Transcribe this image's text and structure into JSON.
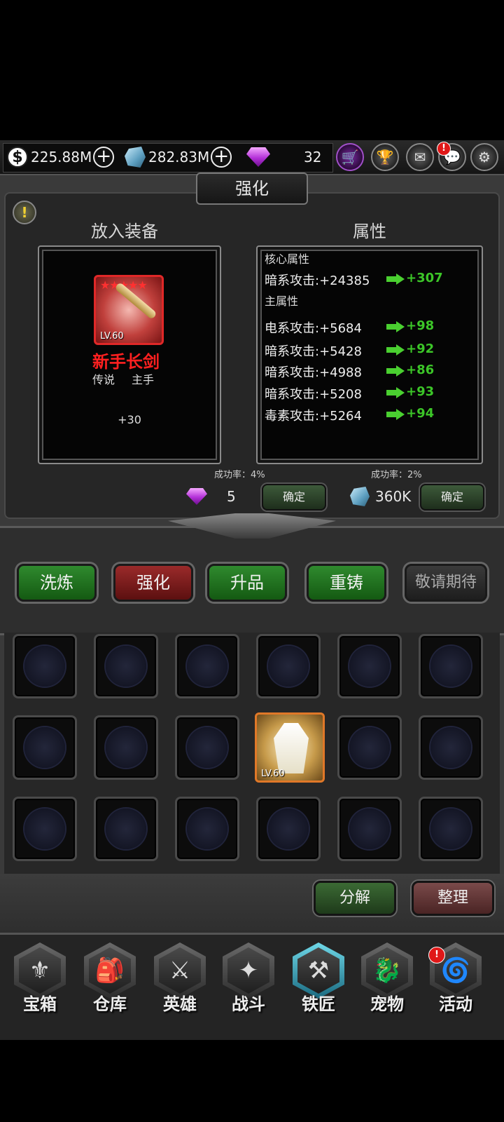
{
  "topbar": {
    "gold_value": "225.88M",
    "crystal_value": "282.83M",
    "gem_value": "32",
    "coin_symbol": "$",
    "plus_symbol": "+",
    "alert_symbol": "!"
  },
  "title": "强化",
  "left_panel": {
    "heading": "放入装备",
    "equipment": {
      "level": "LV.60",
      "stars": "★★★★★",
      "name": "新手长剑",
      "rarity": "传说",
      "slot": "主手",
      "enhance_level": "+30"
    },
    "success_rate": "成功率：4%",
    "gem_cost": "5",
    "confirm": "确定"
  },
  "right_panel": {
    "heading": "属性",
    "core_label": "核心属性",
    "core_attr": {
      "text": "暗系攻击:+24385",
      "bonus": "+307"
    },
    "main_label": "主属性",
    "main_attrs": [
      {
        "text": "电系攻击:+5684",
        "bonus": "+98"
      },
      {
        "text": "暗系攻击:+5428",
        "bonus": "+92"
      },
      {
        "text": "暗系攻击:+4988",
        "bonus": "+86"
      },
      {
        "text": "暗系攻击:+5208",
        "bonus": "+93"
      },
      {
        "text": "毒素攻击:+5264",
        "bonus": "+94"
      }
    ],
    "success_rate": "成功率：2%",
    "crystal_cost": "360K",
    "confirm": "确定"
  },
  "tabs": [
    "洗炼",
    "强化",
    "升品",
    "重铸",
    "敬请期待"
  ],
  "inventory": {
    "item_level": "LV.60"
  },
  "actions": {
    "decompose": "分解",
    "sort": "整理"
  },
  "nav": [
    "宝箱",
    "仓库",
    "英雄",
    "战斗",
    "铁匠",
    "宠物",
    "活动"
  ],
  "nav_icons": [
    "chest-icon",
    "backpack-icon",
    "hero-icon",
    "battle-icon",
    "anvil-icon",
    "pet-icon",
    "event-icon"
  ],
  "colors": {
    "legendary_red": "#ff2020",
    "bonus_green": "#3cc628",
    "active_tab": "#9a2a2a",
    "item_border_orange": "#e07828"
  }
}
